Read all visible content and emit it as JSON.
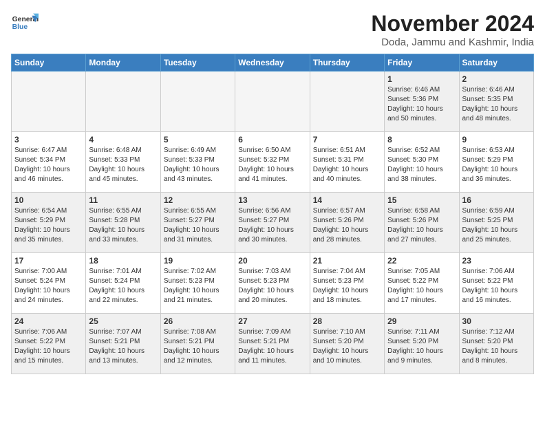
{
  "header": {
    "logo_line1": "General",
    "logo_line2": "Blue",
    "month": "November 2024",
    "location": "Doda, Jammu and Kashmir, India"
  },
  "weekdays": [
    "Sunday",
    "Monday",
    "Tuesday",
    "Wednesday",
    "Thursday",
    "Friday",
    "Saturday"
  ],
  "weeks": [
    [
      {
        "day": "",
        "info": "",
        "empty": true
      },
      {
        "day": "",
        "info": "",
        "empty": true
      },
      {
        "day": "",
        "info": "",
        "empty": true
      },
      {
        "day": "",
        "info": "",
        "empty": true
      },
      {
        "day": "",
        "info": "",
        "empty": true
      },
      {
        "day": "1",
        "info": "Sunrise: 6:46 AM\nSunset: 5:36 PM\nDaylight: 10 hours\nand 50 minutes.",
        "empty": false
      },
      {
        "day": "2",
        "info": "Sunrise: 6:46 AM\nSunset: 5:35 PM\nDaylight: 10 hours\nand 48 minutes.",
        "empty": false
      }
    ],
    [
      {
        "day": "3",
        "info": "Sunrise: 6:47 AM\nSunset: 5:34 PM\nDaylight: 10 hours\nand 46 minutes.",
        "empty": false
      },
      {
        "day": "4",
        "info": "Sunrise: 6:48 AM\nSunset: 5:33 PM\nDaylight: 10 hours\nand 45 minutes.",
        "empty": false
      },
      {
        "day": "5",
        "info": "Sunrise: 6:49 AM\nSunset: 5:33 PM\nDaylight: 10 hours\nand 43 minutes.",
        "empty": false
      },
      {
        "day": "6",
        "info": "Sunrise: 6:50 AM\nSunset: 5:32 PM\nDaylight: 10 hours\nand 41 minutes.",
        "empty": false
      },
      {
        "day": "7",
        "info": "Sunrise: 6:51 AM\nSunset: 5:31 PM\nDaylight: 10 hours\nand 40 minutes.",
        "empty": false
      },
      {
        "day": "8",
        "info": "Sunrise: 6:52 AM\nSunset: 5:30 PM\nDaylight: 10 hours\nand 38 minutes.",
        "empty": false
      },
      {
        "day": "9",
        "info": "Sunrise: 6:53 AM\nSunset: 5:29 PM\nDaylight: 10 hours\nand 36 minutes.",
        "empty": false
      }
    ],
    [
      {
        "day": "10",
        "info": "Sunrise: 6:54 AM\nSunset: 5:29 PM\nDaylight: 10 hours\nand 35 minutes.",
        "empty": false
      },
      {
        "day": "11",
        "info": "Sunrise: 6:55 AM\nSunset: 5:28 PM\nDaylight: 10 hours\nand 33 minutes.",
        "empty": false
      },
      {
        "day": "12",
        "info": "Sunrise: 6:55 AM\nSunset: 5:27 PM\nDaylight: 10 hours\nand 31 minutes.",
        "empty": false
      },
      {
        "day": "13",
        "info": "Sunrise: 6:56 AM\nSunset: 5:27 PM\nDaylight: 10 hours\nand 30 minutes.",
        "empty": false
      },
      {
        "day": "14",
        "info": "Sunrise: 6:57 AM\nSunset: 5:26 PM\nDaylight: 10 hours\nand 28 minutes.",
        "empty": false
      },
      {
        "day": "15",
        "info": "Sunrise: 6:58 AM\nSunset: 5:26 PM\nDaylight: 10 hours\nand 27 minutes.",
        "empty": false
      },
      {
        "day": "16",
        "info": "Sunrise: 6:59 AM\nSunset: 5:25 PM\nDaylight: 10 hours\nand 25 minutes.",
        "empty": false
      }
    ],
    [
      {
        "day": "17",
        "info": "Sunrise: 7:00 AM\nSunset: 5:24 PM\nDaylight: 10 hours\nand 24 minutes.",
        "empty": false
      },
      {
        "day": "18",
        "info": "Sunrise: 7:01 AM\nSunset: 5:24 PM\nDaylight: 10 hours\nand 22 minutes.",
        "empty": false
      },
      {
        "day": "19",
        "info": "Sunrise: 7:02 AM\nSunset: 5:23 PM\nDaylight: 10 hours\nand 21 minutes.",
        "empty": false
      },
      {
        "day": "20",
        "info": "Sunrise: 7:03 AM\nSunset: 5:23 PM\nDaylight: 10 hours\nand 20 minutes.",
        "empty": false
      },
      {
        "day": "21",
        "info": "Sunrise: 7:04 AM\nSunset: 5:23 PM\nDaylight: 10 hours\nand 18 minutes.",
        "empty": false
      },
      {
        "day": "22",
        "info": "Sunrise: 7:05 AM\nSunset: 5:22 PM\nDaylight: 10 hours\nand 17 minutes.",
        "empty": false
      },
      {
        "day": "23",
        "info": "Sunrise: 7:06 AM\nSunset: 5:22 PM\nDaylight: 10 hours\nand 16 minutes.",
        "empty": false
      }
    ],
    [
      {
        "day": "24",
        "info": "Sunrise: 7:06 AM\nSunset: 5:22 PM\nDaylight: 10 hours\nand 15 minutes.",
        "empty": false
      },
      {
        "day": "25",
        "info": "Sunrise: 7:07 AM\nSunset: 5:21 PM\nDaylight: 10 hours\nand 13 minutes.",
        "empty": false
      },
      {
        "day": "26",
        "info": "Sunrise: 7:08 AM\nSunset: 5:21 PM\nDaylight: 10 hours\nand 12 minutes.",
        "empty": false
      },
      {
        "day": "27",
        "info": "Sunrise: 7:09 AM\nSunset: 5:21 PM\nDaylight: 10 hours\nand 11 minutes.",
        "empty": false
      },
      {
        "day": "28",
        "info": "Sunrise: 7:10 AM\nSunset: 5:20 PM\nDaylight: 10 hours\nand 10 minutes.",
        "empty": false
      },
      {
        "day": "29",
        "info": "Sunrise: 7:11 AM\nSunset: 5:20 PM\nDaylight: 10 hours\nand 9 minutes.",
        "empty": false
      },
      {
        "day": "30",
        "info": "Sunrise: 7:12 AM\nSunset: 5:20 PM\nDaylight: 10 hours\nand 8 minutes.",
        "empty": false
      }
    ]
  ]
}
